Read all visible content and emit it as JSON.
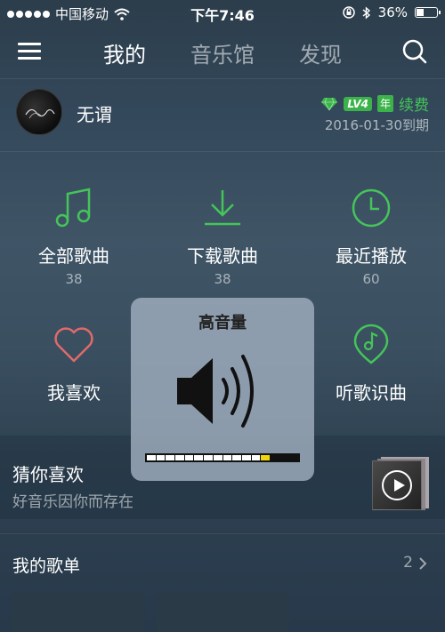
{
  "status_bar": {
    "carrier": "中国移动",
    "time": "下午7:46",
    "battery": "36%",
    "battery_level": 0.36,
    "signal_bars": 5
  },
  "nav": {
    "tabs": [
      {
        "label": "我的",
        "active": true
      },
      {
        "label": "音乐馆",
        "active": false
      },
      {
        "label": "发现",
        "active": false
      }
    ]
  },
  "profile": {
    "name": "无谓",
    "level_badge": "LV4",
    "year_badge": "年",
    "renew_label": "续费",
    "expire_text": "2016-01-30到期"
  },
  "grid": [
    {
      "label": "全部歌曲",
      "count": "38",
      "icon": "music-note-icon"
    },
    {
      "label": "下载歌曲",
      "count": "38",
      "icon": "download-icon"
    },
    {
      "label": "最近播放",
      "count": "60",
      "icon": "clock-icon"
    },
    {
      "label": "我喜欢",
      "count": "",
      "icon": "heart-icon"
    },
    {
      "label": "听歌识曲",
      "count": "",
      "icon": "music-recognize-icon"
    }
  ],
  "volume_hud": {
    "title": "高音量",
    "level_segments": 16,
    "filled_segments": 13
  },
  "recommend": {
    "title": "猜你喜欢",
    "subtitle": "好音乐因你而存在"
  },
  "playlist": {
    "title": "我的歌单",
    "count": "2"
  },
  "colors": {
    "accent_green": "#45c45a",
    "heart_red": "#e06a6a",
    "volume_yellow": "#f2d60c"
  }
}
